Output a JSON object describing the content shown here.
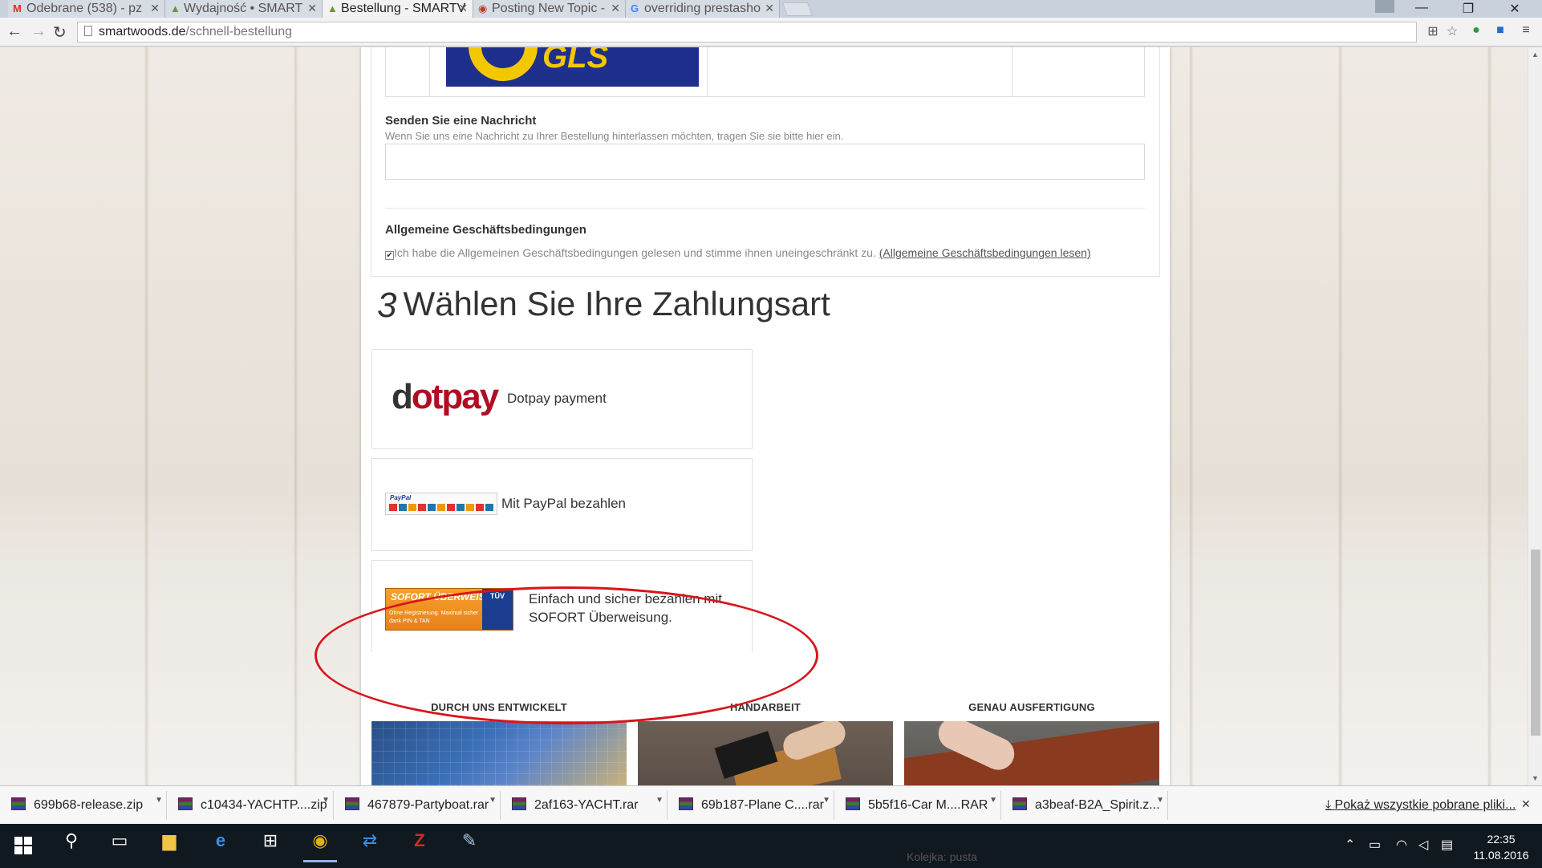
{
  "tabs": [
    {
      "icon": "M",
      "label": "Odebrane (538) - pz",
      "active": false
    },
    {
      "icon": "▲",
      "label": "Wydajność • SMART",
      "active": false
    },
    {
      "icon": "▲",
      "label": "Bestellung - SMARTV",
      "active": true
    },
    {
      "icon": "◉",
      "label": "Posting New Topic -",
      "active": false
    },
    {
      "icon": "G",
      "label": "overriding prestasho",
      "active": false
    }
  ],
  "window": {
    "minimize": "—",
    "restore": "❐",
    "close": "✕"
  },
  "address": {
    "domain": "smartwoods.de",
    "path": "/schnell-bestellung"
  },
  "message_section": {
    "title": "Senden Sie eine Nachricht",
    "hint": "Wenn Sie uns eine Nachricht zu Ihrer Bestellung hinterlassen möchten, tragen Sie sie bitte hier ein.",
    "value": ""
  },
  "terms_section": {
    "title": "Allgemeine Geschäftsbedingungen",
    "checkbox_text": "Ich habe die Allgemeinen Geschäftsbedingungen gelesen und stimme ihnen uneingeschränkt zu.",
    "link_text": "(Allgemeine Geschäftsbedingungen lesen)",
    "checked": true
  },
  "payment_step": {
    "number": "3",
    "title": "Wählen Sie Ihre Zahlungsart"
  },
  "payment_methods": [
    {
      "logo_text": "dotpay",
      "label": "Dotpay payment"
    },
    {
      "logo_text": "PayPal",
      "label": "Mit PayPal bezahlen"
    },
    {
      "logo_text": "SOFORT ÜBERWEISUNG",
      "logo_sub": "Ohne Registrierung. Maximal sicher dank PIN & TAN",
      "badge": "TÜV",
      "label_line1": "Einfach und sicher bezahlen mit",
      "label_line2": "SOFORT Überweisung."
    }
  ],
  "features": [
    {
      "label": "DURCH UNS ENTWICKELT"
    },
    {
      "label": "HANDARBEIT"
    },
    {
      "label": "GENAU AUSFERTIGUNG"
    }
  ],
  "downloads": [
    {
      "name": "699b68-release.zip"
    },
    {
      "name": "c10434-YACHTP....zip"
    },
    {
      "name": "467879-Partyboat.rar"
    },
    {
      "name": "2af163-YACHT.rar"
    },
    {
      "name": "69b187-Plane C....rar"
    },
    {
      "name": "5b5f16-Car M....RAR"
    },
    {
      "name": "a3beaf-B2A_Spirit.z..."
    }
  ],
  "downloads_show_all": "Pokaż wszystkie pobrane pliki...",
  "taskbar": {
    "shadow_text": "Kolejka: pusta"
  },
  "clock": {
    "time": "22:35",
    "date": "11.08.2016"
  }
}
